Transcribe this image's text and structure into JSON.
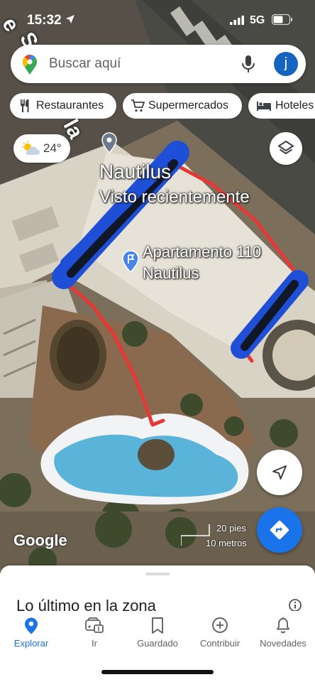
{
  "status_bar": {
    "time": "15:32",
    "network": "5G"
  },
  "search": {
    "placeholder": "Buscar aquí",
    "avatar_letter": "j"
  },
  "chips": [
    {
      "label": "Restaurantes",
      "icon": "utensils-icon"
    },
    {
      "label": "Supermercados",
      "icon": "cart-icon"
    },
    {
      "label": "Hoteles",
      "icon": "bed-icon"
    }
  ],
  "weather": {
    "temperature": "24°",
    "icon": "partly-cloudy-icon"
  },
  "map": {
    "street_name_1": "e",
    "street_name_2": "S",
    "street_name_3": "la",
    "place_name": "Nautilus",
    "place_subtitle": "Visto recientemente",
    "pin_name_line1": "Apartamento 110",
    "pin_name_line2": "Nautilus",
    "logo": "Google",
    "scale_feet": "20 pies",
    "scale_meters": "10 metros",
    "annotation_colors": {
      "outline": "#e53935",
      "scribble": "#1f4fd6",
      "scribble_dark": "#101828"
    }
  },
  "bottom_sheet": {
    "title": "Lo último en la zona"
  },
  "bottom_nav": [
    {
      "label": "Explorar",
      "icon": "explore-pin-icon",
      "active": true
    },
    {
      "label": "Ir",
      "icon": "car-icon",
      "active": false
    },
    {
      "label": "Guardado",
      "icon": "bookmark-icon",
      "active": false
    },
    {
      "label": "Contribuir",
      "icon": "plus-circle-icon",
      "active": false
    },
    {
      "label": "Novedades",
      "icon": "bell-icon",
      "active": false
    }
  ],
  "colors": {
    "accent": "#1a73e8",
    "avatar": "#1565c0"
  }
}
